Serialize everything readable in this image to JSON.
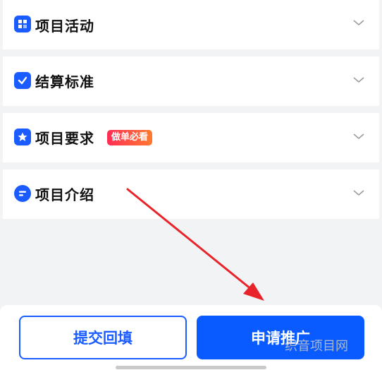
{
  "sections": [
    {
      "label": "项目活动",
      "icon": "grid-icon"
    },
    {
      "label": "结算标准",
      "icon": "check-icon"
    },
    {
      "label": "项目要求",
      "icon": "star-icon",
      "badge": "做单必看"
    },
    {
      "label": "项目介绍",
      "icon": "list-icon"
    }
  ],
  "footer": {
    "submit_label": "提交回填",
    "apply_label": "申请推广"
  },
  "watermark": "织音项目网",
  "colors": {
    "accent": "#0a5bff",
    "badge_start": "#ff2d55",
    "badge_end": "#ff7a2e",
    "annotation_arrow": "#e8242a"
  }
}
